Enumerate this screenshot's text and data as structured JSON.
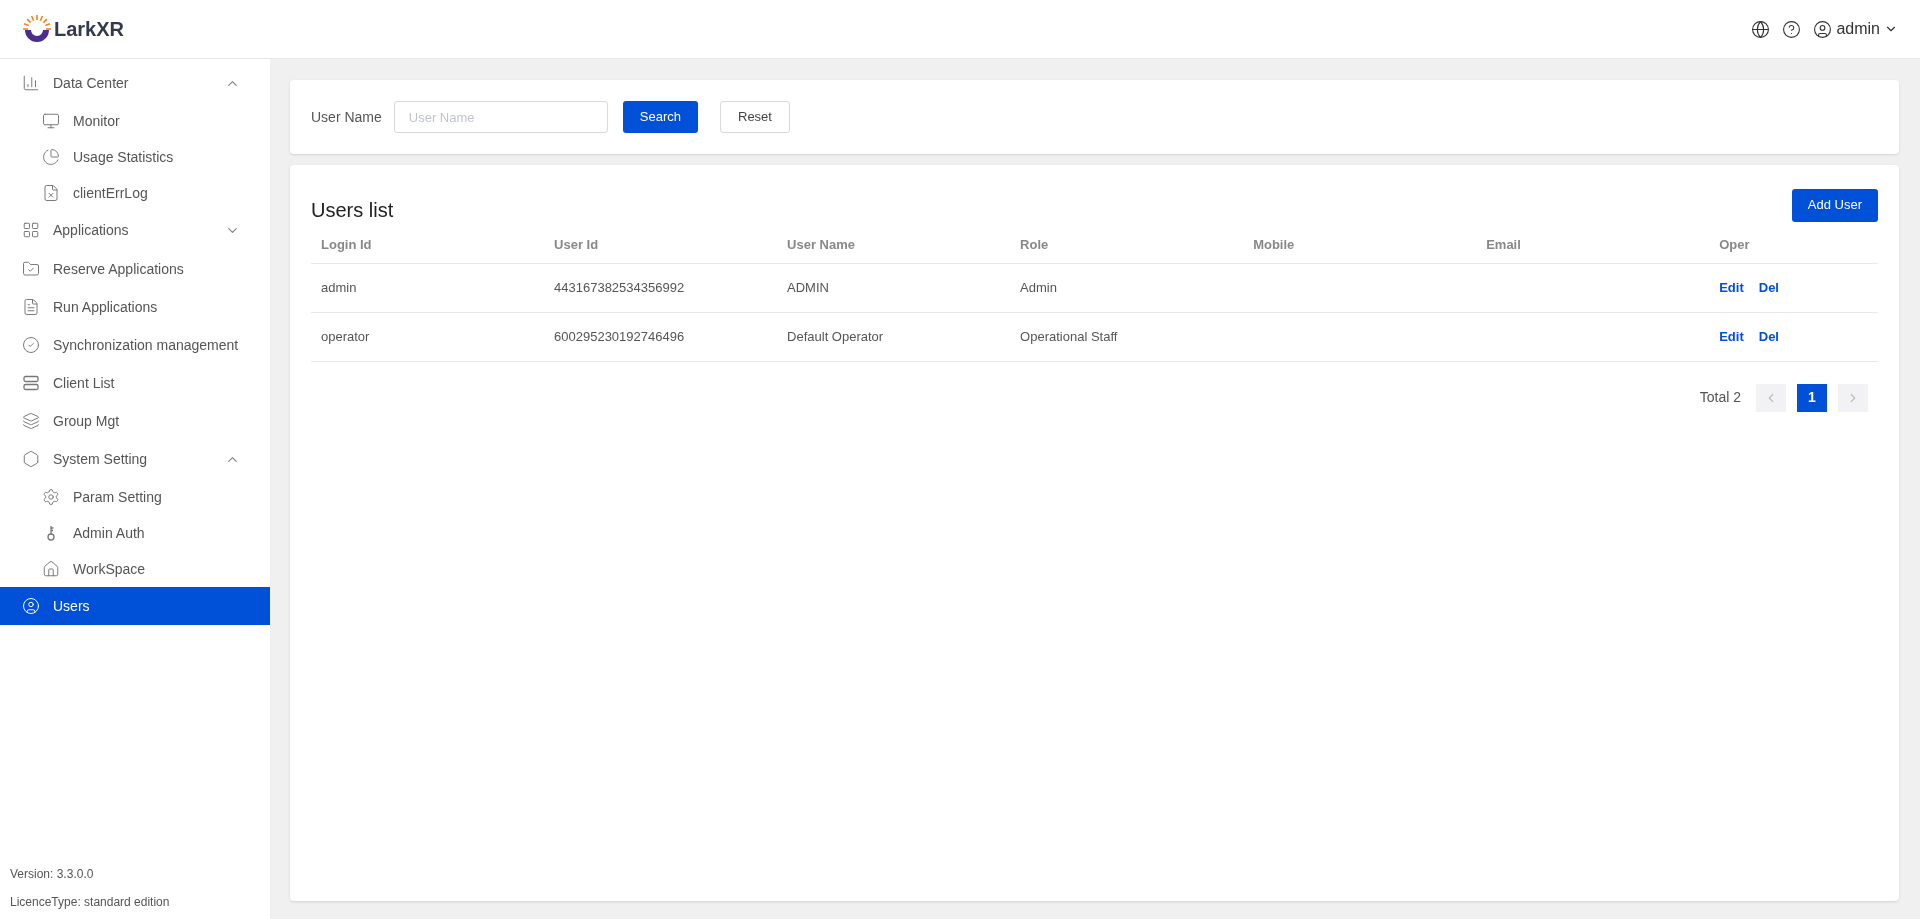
{
  "logo": {
    "text": "LarkXR"
  },
  "header": {
    "user": "admin"
  },
  "sidebar": {
    "items": [
      {
        "label": "Data Center",
        "selected": false,
        "expanded": true,
        "children": [
          {
            "label": "Monitor",
            "selected": false
          },
          {
            "label": "Usage Statistics",
            "selected": false
          },
          {
            "label": "clientErrLog",
            "selected": false
          }
        ]
      },
      {
        "label": "Applications",
        "selected": false,
        "expanded": false
      },
      {
        "label": "Reserve Applications",
        "selected": false
      },
      {
        "label": "Run Applications",
        "selected": false
      },
      {
        "label": "Synchronization management",
        "selected": false
      },
      {
        "label": "Client List",
        "selected": false
      },
      {
        "label": "Group Mgt",
        "selected": false
      },
      {
        "label": "System Setting",
        "selected": false,
        "expanded": true,
        "children": [
          {
            "label": "Param Setting",
            "selected": false
          },
          {
            "label": "Admin Auth",
            "selected": false
          },
          {
            "label": "WorkSpace",
            "selected": false
          }
        ]
      },
      {
        "label": "Users",
        "selected": true
      }
    ],
    "version": "Version: 3.3.0.0",
    "licence": "LicenceType: standard edition"
  },
  "search": {
    "label": "User Name",
    "placeholder": "User Name",
    "buttons": [
      "Search",
      "Reset"
    ]
  },
  "users": {
    "title": "Users list",
    "add_button": "Add User",
    "columns": [
      "Login Id",
      "User Id",
      "User Name",
      "Role",
      "Mobile",
      "Email",
      "Oper"
    ],
    "rows": [
      {
        "cells": [
          "admin",
          "443167382534356992",
          "ADMIN",
          "Admin"
        ],
        "actions": [
          "Edit",
          "Del"
        ]
      },
      {
        "cells": [
          "operator",
          "600295230192746496",
          "Default Operator",
          "Operational Staff"
        ],
        "actions": [
          "Edit",
          "Del"
        ]
      }
    ],
    "pagination": {
      "total": "Total 2",
      "pages": [
        {
          "label": "1",
          "selected": true
        }
      ]
    }
  }
}
